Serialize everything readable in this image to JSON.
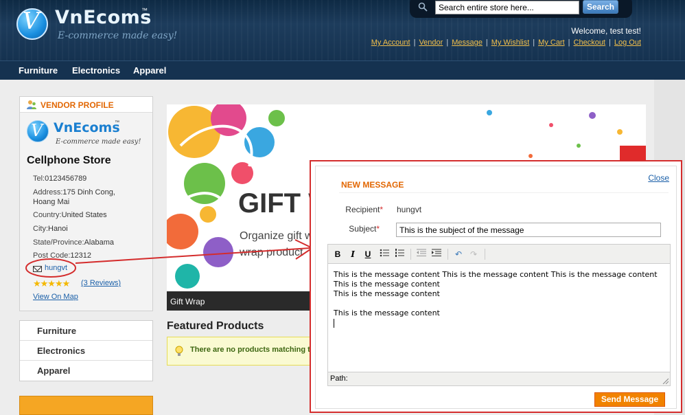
{
  "header": {
    "logo_name": "VnEcoms",
    "logo_tm": "™",
    "logo_tagline": "E-commerce made easy!",
    "search_placeholder": "Search entire store here...",
    "search_button": "Search",
    "welcome": "Welcome, test test!",
    "links": [
      "My Account",
      "Vendor",
      "Message",
      "My Wishlist",
      "My Cart",
      "Checkout",
      "Log Out"
    ]
  },
  "nav": {
    "items": [
      "Furniture",
      "Electronics",
      "Apparel"
    ]
  },
  "vendor": {
    "heading": "VENDOR PROFILE",
    "logo_name": "VnEcoms",
    "logo_tm": "™",
    "logo_tagline": "E-commerce made easy!",
    "store_name": "Cellphone Store",
    "tel_label": "Tel:",
    "tel": "0123456789",
    "address_label": "Address:",
    "address_1": "175 Dinh Cong,",
    "address_2": "Hoang Mai",
    "country_label": "Country:",
    "country": "United States",
    "city_label": "City:",
    "city": "Hanoi",
    "state_label": "State/Province:",
    "state": "Alabama",
    "postcode_label": "Post Code:",
    "postcode": "12312",
    "username": "hungvt",
    "rating": 5,
    "reviews": "(3 Reviews)",
    "view_map": "View On Map"
  },
  "categories": [
    "Furniture",
    "Electronics",
    "Apparel"
  ],
  "banner": {
    "title": "GIFT W",
    "subtitle_1": "Organize gift w",
    "subtitle_2": "wrap product",
    "caption": "Gift Wrap"
  },
  "featured": {
    "heading": "Featured Products",
    "notice": "There are no products matching t"
  },
  "modal": {
    "close": "Close",
    "title": "NEW MESSAGE",
    "recipient_label": "Recipient",
    "recipient": "hungvt",
    "subject_label": "Subject",
    "subject": "This is the subject of the message",
    "body_lines": [
      "This is the message content This is the message content This is the message content",
      "This is the message content",
      "This is the message content",
      "",
      "This is the message content"
    ],
    "path_label": "Path:",
    "send_button": "Send Message"
  },
  "colors": {
    "accent_orange": "#e26703",
    "annotation_red": "#d42c2c",
    "link_blue": "#1a5fa8",
    "nav_bg": "#153250"
  }
}
